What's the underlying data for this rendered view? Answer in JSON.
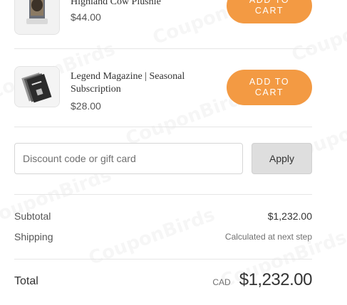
{
  "watermark": {
    "text": "CouponBirds"
  },
  "cart": {
    "items": [
      {
        "title": "Highland Cow Plushie",
        "price": "$44.00",
        "button_label": "ADD TO CART"
      },
      {
        "title": "Legend Magazine | Seasonal Subscription",
        "price": "$28.00",
        "button_label": "ADD TO CART"
      }
    ]
  },
  "discount": {
    "placeholder": "Discount code or gift card",
    "apply_label": "Apply"
  },
  "summary": {
    "subtotal_label": "Subtotal",
    "subtotal_value": "$1,232.00",
    "shipping_label": "Shipping",
    "shipping_value": "Calculated at next step",
    "total_label": "Total",
    "currency": "CAD",
    "total_value": "$1,232.00"
  },
  "colors": {
    "accent": "#f39a43",
    "apply_bg": "#dedede",
    "divider": "#e6e6e6"
  }
}
